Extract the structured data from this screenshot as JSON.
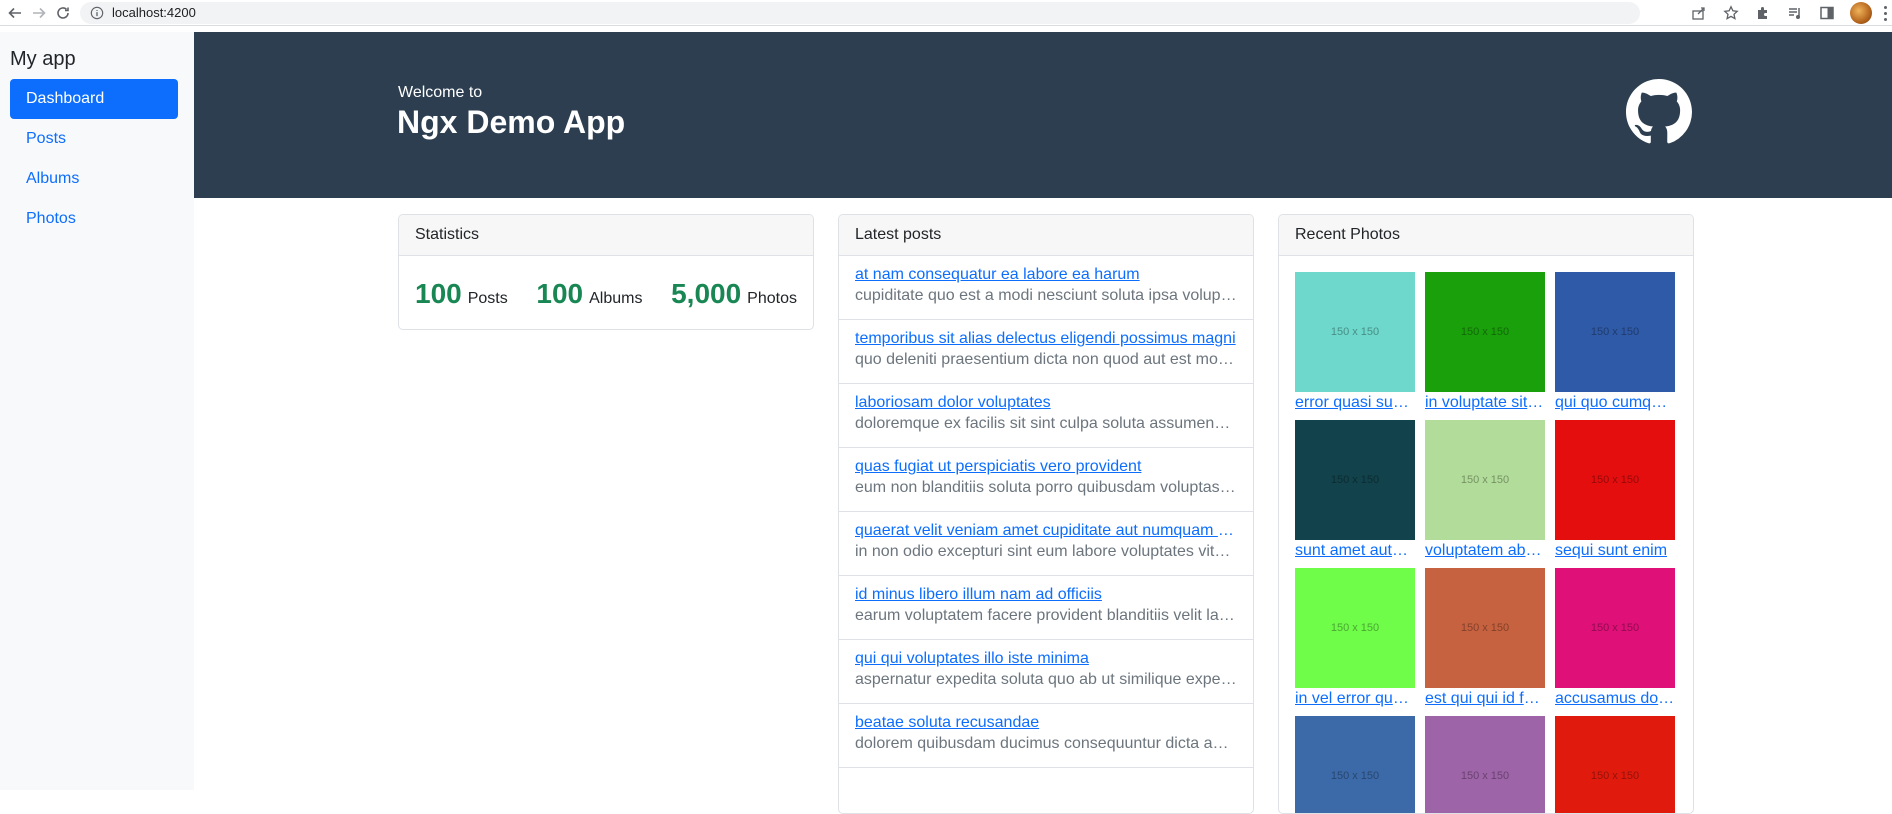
{
  "browser": {
    "url": "localhost:4200"
  },
  "sidebar": {
    "brand": "My app",
    "items": [
      {
        "label": "Dashboard",
        "active": true
      },
      {
        "label": "Posts",
        "active": false
      },
      {
        "label": "Albums",
        "active": false
      },
      {
        "label": "Photos",
        "active": false
      }
    ]
  },
  "hero": {
    "welcome": "Welcome to",
    "title": "Ngx Demo App",
    "github_icon": "github-icon",
    "background": "#2c3e50"
  },
  "statistics": {
    "header": "Statistics",
    "items": [
      {
        "value": "100",
        "label": "Posts"
      },
      {
        "value": "100",
        "label": "Albums"
      },
      {
        "value": "5,000",
        "label": "Photos"
      }
    ],
    "value_color": "#198754"
  },
  "latest_posts": {
    "header": "Latest posts",
    "items": [
      {
        "title": "at nam consequatur ea labore ea harum",
        "body": "cupiditate quo est a modi nesciunt soluta ipsa voluptas error itaque dicta in autem qui minus magnam et distinctio eum"
      },
      {
        "title": "temporibus sit alias delectus eligendi possimus magni",
        "body": "quo deleniti praesentium dicta non quod aut est molestias molestias et officia quis nihil"
      },
      {
        "title": "laboriosam dolor voluptates",
        "body": "doloremque ex facilis sit sint culpa soluta assumenda eligendi non ut eius"
      },
      {
        "title": "quas fugiat ut perspiciatis vero provident",
        "body": "eum non blanditiis soluta porro quibusdam voluptas vel voluptatem qui placeat dolores qui velit aut"
      },
      {
        "title": "quaerat velit veniam amet cupiditate aut numquam ut sequi",
        "body": "in non odio excepturi sint eum labore voluptates vitae quia qui et inventore itaque rerum"
      },
      {
        "title": "id minus libero illum nam ad officiis",
        "body": "earum voluptatem facere provident blanditiis velit laboriosam pariatur accusamus odio saepe"
      },
      {
        "title": "qui qui voluptates illo iste minima",
        "body": "aspernatur expedita soluta quo ab ut similique expedita dolores amet sed temporibus distinctio"
      },
      {
        "title": "beatae soluta recusandae",
        "body": "dolorem quibusdam ducimus consequuntur dicta aut quo laboriosam voluptatem quis enim recusandae ut sed sunt"
      }
    ]
  },
  "recent_photos": {
    "header": "Recent Photos",
    "placeholder_text": "150 x 150",
    "items": [
      {
        "caption": "error quasi sunt cupiditate voluptate ea odit beatae",
        "color": "#6dd8cb"
      },
      {
        "caption": "in voluptate sit officia non nesciunt quis",
        "color": "#1aa00b"
      },
      {
        "caption": "qui quo cumque distinctio aut voluptas",
        "color": "#2f5aa7"
      },
      {
        "caption": "sunt amet autem quibusdam",
        "color": "#12424b"
      },
      {
        "caption": "voluptatem ab quisquam",
        "color": "#b2dc99"
      },
      {
        "caption": "sequi sunt enim",
        "color": "#e50e0e"
      },
      {
        "caption": "in vel error quaerat",
        "color": "#6ffd4a"
      },
      {
        "caption": "est qui qui id facilis",
        "color": "#c76240"
      },
      {
        "caption": "accusamus dolores",
        "color": "#df1078"
      },
      {
        "caption": "",
        "color": "#3c6aa8"
      },
      {
        "caption": "",
        "color": "#9e64a8"
      },
      {
        "caption": "",
        "color": "#e01b0e"
      }
    ]
  }
}
